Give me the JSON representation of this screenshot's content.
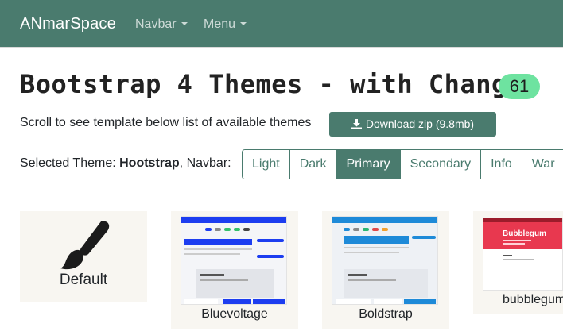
{
  "navbar": {
    "brand": "ANmarSpace",
    "items": [
      {
        "label": "Navbar"
      },
      {
        "label": "Menu"
      }
    ]
  },
  "header": {
    "title": "Bootstrap 4 Themes - with Changer",
    "count": "61"
  },
  "intro": {
    "text": "Scroll to see template below list of available themes",
    "download_label": "Download zip (9.8mb)"
  },
  "selection": {
    "prefix": "Selected Theme: ",
    "theme": "Hootstrap",
    "suffix": ", Navbar:",
    "options": [
      "Light",
      "Dark",
      "Primary",
      "Secondary",
      "Info",
      "War"
    ],
    "active": "Primary"
  },
  "themes": [
    {
      "name": "Default"
    },
    {
      "name": "Bluevoltage"
    },
    {
      "name": "Boldstrap"
    },
    {
      "name": "bubblegum"
    }
  ],
  "thumbs": {
    "bubblegum_title": "Bubblegum"
  },
  "colors": {
    "primary": "#4a7b6e",
    "badge": "#6ee3a0",
    "bluevoltage": "#1c3df0",
    "boldstrap": "#1e8ad8",
    "bubblegum": "#e8384f"
  }
}
